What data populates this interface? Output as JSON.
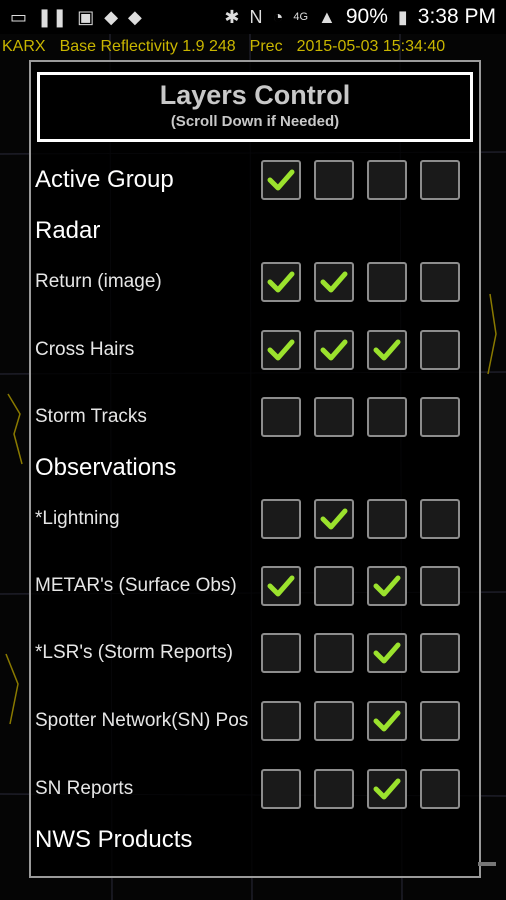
{
  "statusbar": {
    "time": "3:38 PM",
    "battery": "90%",
    "network": "4G"
  },
  "map_header": {
    "station": "KARX",
    "product": "Base Reflectivity 1.9 248",
    "mode": "Prec",
    "datetime": "2015-05-03 15:34:40"
  },
  "dialog": {
    "title": "Layers Control",
    "subtitle": "(Scroll Down if Needed)",
    "rows": [
      {
        "type": "group",
        "label": "Active Group",
        "checks": [
          true,
          false,
          false,
          false
        ]
      },
      {
        "type": "section",
        "label": "Radar"
      },
      {
        "type": "item",
        "label": "Return (image)",
        "checks": [
          true,
          true,
          false,
          false
        ]
      },
      {
        "type": "item",
        "label": "Cross Hairs",
        "checks": [
          true,
          true,
          true,
          false
        ]
      },
      {
        "type": "item",
        "label": "Storm Tracks",
        "checks": [
          false,
          false,
          false,
          false
        ]
      },
      {
        "type": "section",
        "label": "Observations"
      },
      {
        "type": "item",
        "label": "*Lightning",
        "checks": [
          false,
          true,
          false,
          false
        ]
      },
      {
        "type": "item",
        "label": "METAR's (Surface Obs)",
        "checks": [
          true,
          false,
          true,
          false
        ]
      },
      {
        "type": "item",
        "label": "*LSR's (Storm Reports)",
        "checks": [
          false,
          false,
          true,
          false
        ]
      },
      {
        "type": "item",
        "label": "Spotter Network(SN) Pos",
        "checks": [
          false,
          false,
          true,
          false
        ]
      },
      {
        "type": "item",
        "label": "SN Reports",
        "checks": [
          false,
          false,
          true,
          false
        ]
      },
      {
        "type": "section",
        "label": "NWS Products"
      }
    ]
  },
  "colors": {
    "check": "#9be22d",
    "map_text": "#c9b600",
    "dialog_border": "#9a9a9a"
  }
}
